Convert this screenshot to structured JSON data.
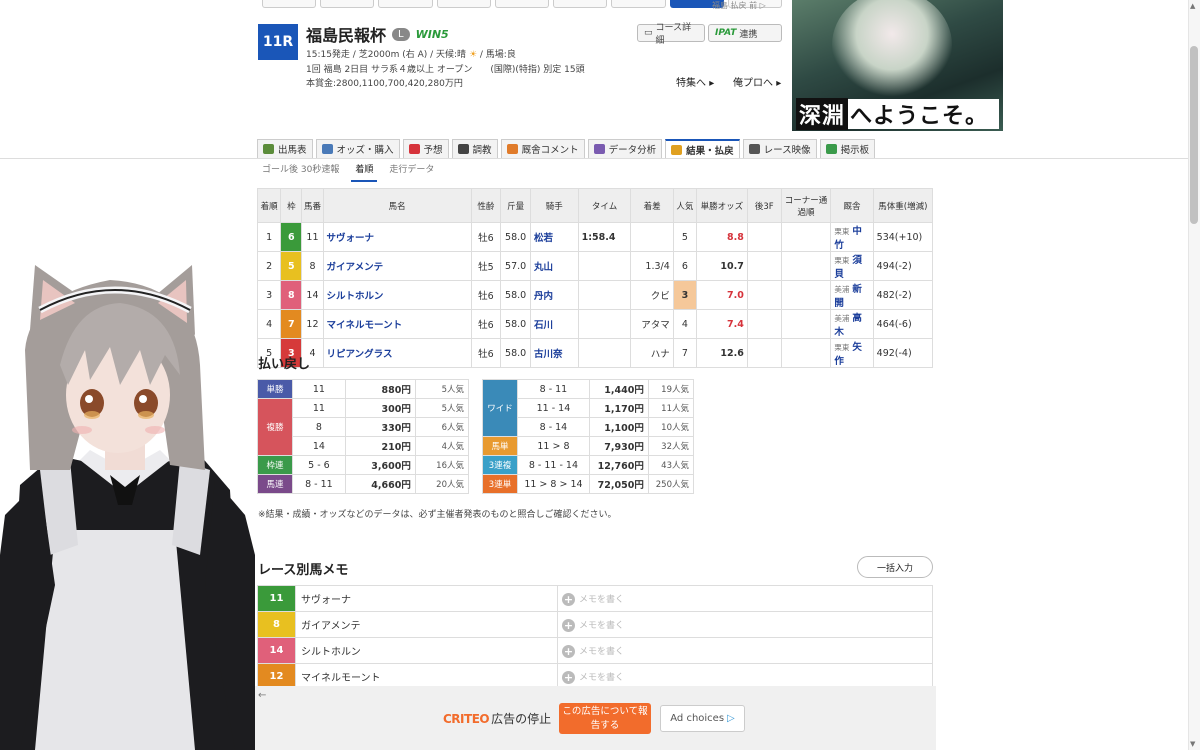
{
  "top": {
    "strip_tabs": 9,
    "active_index": 7,
    "right_text": "福島  払戻  前 ▷"
  },
  "race": {
    "number": "11R",
    "name": "福島民報杯",
    "grade": "L",
    "win5": "WIN5",
    "line1_a": "15:15発走 / 芝2000m (右 A) / 天候:晴",
    "line1_b": "/ 馬場:良",
    "line2": "1回 福島 2日目 サラ系４歳以上 オープン　　(国際)(特指) 別定 15頭",
    "line3": "本賞金:2800,1100,700,420,280万円",
    "btn_course": "コース詳細",
    "btn_ipat_brand": "IPAT",
    "btn_ipat": "連携",
    "link_toku": "特集へ",
    "link_ore": "俺プロへ"
  },
  "top_ad": {
    "text_a": "深淵",
    "text_b": "へようこそ。"
  },
  "tabs": [
    {
      "label": "出馬表",
      "color": "#5b8c3a"
    },
    {
      "label": "オッズ・購入",
      "color": "#4a7ab8"
    },
    {
      "label": "予想",
      "color": "#d6333b"
    },
    {
      "label": "調教",
      "color": "#444444"
    },
    {
      "label": "厩舎コメント",
      "color": "#e07b2a"
    },
    {
      "label": "データ分析",
      "color": "#7a5bb0"
    },
    {
      "label": "結果・払戻",
      "color": "#e0a020"
    },
    {
      "label": "レース映像",
      "color": "#555555"
    },
    {
      "label": "掲示板",
      "color": "#3a9a4a"
    }
  ],
  "subtabs": [
    "ゴール後 30秒速報",
    "着順",
    "走行データ"
  ],
  "result": {
    "headers": [
      "着順",
      "枠",
      "馬番",
      "馬名",
      "性齢",
      "斤量",
      "騎手",
      "タイム",
      "着差",
      "人気",
      "単勝オッズ",
      "後3F",
      "コーナー通過順",
      "厩舎",
      "馬体重(増減)"
    ],
    "rows": [
      {
        "pos": "1",
        "waku": "6",
        "wcolor": "#3a9a3a",
        "num": "11",
        "name": "サヴォーナ",
        "sex": "牡6",
        "kin": "58.0",
        "jockey": "松若",
        "time": "1:58.4",
        "margin": "",
        "pop": "5",
        "odds": "8.8",
        "red": true,
        "area": "栗東",
        "trainer": "中竹",
        "weight": "534(+10)"
      },
      {
        "pos": "2",
        "waku": "5",
        "wcolor": "#e8c020",
        "num": "8",
        "name": "ガイアメンテ",
        "sex": "牡5",
        "kin": "57.0",
        "jockey": "丸山",
        "time": "",
        "margin": "1.3/4",
        "pop": "6",
        "odds": "10.7",
        "red": false,
        "area": "栗東",
        "trainer": "須貝",
        "weight": "494(-2)"
      },
      {
        "pos": "3",
        "waku": "8",
        "wcolor": "#e0607a",
        "num": "14",
        "name": "シルトホルン",
        "sex": "牡6",
        "kin": "58.0",
        "jockey": "丹内",
        "time": "",
        "margin": "クビ",
        "pop": "3",
        "odds": "7.0",
        "red": true,
        "area": "美浦",
        "trainer": "新開",
        "weight": "482(-2)"
      },
      {
        "pos": "4",
        "waku": "7",
        "wcolor": "#e38a20",
        "num": "12",
        "name": "マイネルモーント",
        "sex": "牡6",
        "kin": "58.0",
        "jockey": "石川",
        "time": "",
        "margin": "アタマ",
        "pop": "4",
        "odds": "7.4",
        "red": true,
        "area": "美浦",
        "trainer": "高木",
        "weight": "464(-6)"
      },
      {
        "pos": "5",
        "waku": "3",
        "wcolor": "#d63a3a",
        "num": "4",
        "name": "リピアングラス",
        "sex": "牡6",
        "kin": "58.0",
        "jockey": "古川奈",
        "time": "",
        "margin": "ハナ",
        "pop": "7",
        "odds": "12.6",
        "red": false,
        "area": "栗東",
        "trainer": "矢作",
        "weight": "492(-4)"
      }
    ]
  },
  "payout": {
    "title": "払い戻し",
    "left": [
      {
        "type": "単勝",
        "color": "#4a5aa8",
        "items": [
          [
            "11",
            "880円",
            "5人気"
          ]
        ]
      },
      {
        "type": "複勝",
        "color": "#d6545c",
        "items": [
          [
            "11",
            "300円",
            "5人気"
          ],
          [
            "8",
            "330円",
            "6人気"
          ],
          [
            "14",
            "210円",
            "4人気"
          ]
        ]
      },
      {
        "type": "枠連",
        "color": "#3a9a4a",
        "items": [
          [
            "5 - 6",
            "3,600円",
            "16人気"
          ]
        ]
      },
      {
        "type": "馬連",
        "color": "#7a4a8a",
        "items": [
          [
            "8 - 11",
            "4,660円",
            "20人気"
          ]
        ]
      }
    ],
    "right": [
      {
        "type": "ワイド",
        "color": "#3a8ab8",
        "items": [
          [
            "8 - 11",
            "1,440円",
            "19人気"
          ],
          [
            "11 - 14",
            "1,170円",
            "11人気"
          ],
          [
            "8 - 14",
            "1,100円",
            "10人気"
          ]
        ]
      },
      {
        "type": "馬単",
        "color": "#e89a30",
        "items": [
          [
            "11 > 8",
            "7,930円",
            "32人気"
          ]
        ]
      },
      {
        "type": "3連複",
        "color": "#3aa0c8",
        "items": [
          [
            "8 - 11 - 14",
            "12,760円",
            "43人気"
          ]
        ]
      },
      {
        "type": "3連単",
        "color": "#e8702a",
        "items": [
          [
            "11 > 8 > 14",
            "72,050円",
            "250人気"
          ]
        ]
      }
    ],
    "note": "※結果・成績・オッズなどのデータは、必ず主催者発表のものと照合しご確認ください。"
  },
  "memo": {
    "title": "レース別馬メモ",
    "bulk_btn": "一括入力",
    "placeholder": "メモを書く",
    "rows": [
      {
        "num": "11",
        "color": "#3a9a3a",
        "name": "サヴォーナ"
      },
      {
        "num": "8",
        "color": "#e8c020",
        "name": "ガイアメンテ"
      },
      {
        "num": "14",
        "color": "#e0607a",
        "name": "シルトホルン"
      },
      {
        "num": "12",
        "color": "#e38a20",
        "name": "マイネルモーント"
      }
    ]
  },
  "bottom_ad": {
    "brand": "CRITEO",
    "stop": "広告の停止",
    "report": "この広告について報告する",
    "choices": "Ad choices"
  }
}
